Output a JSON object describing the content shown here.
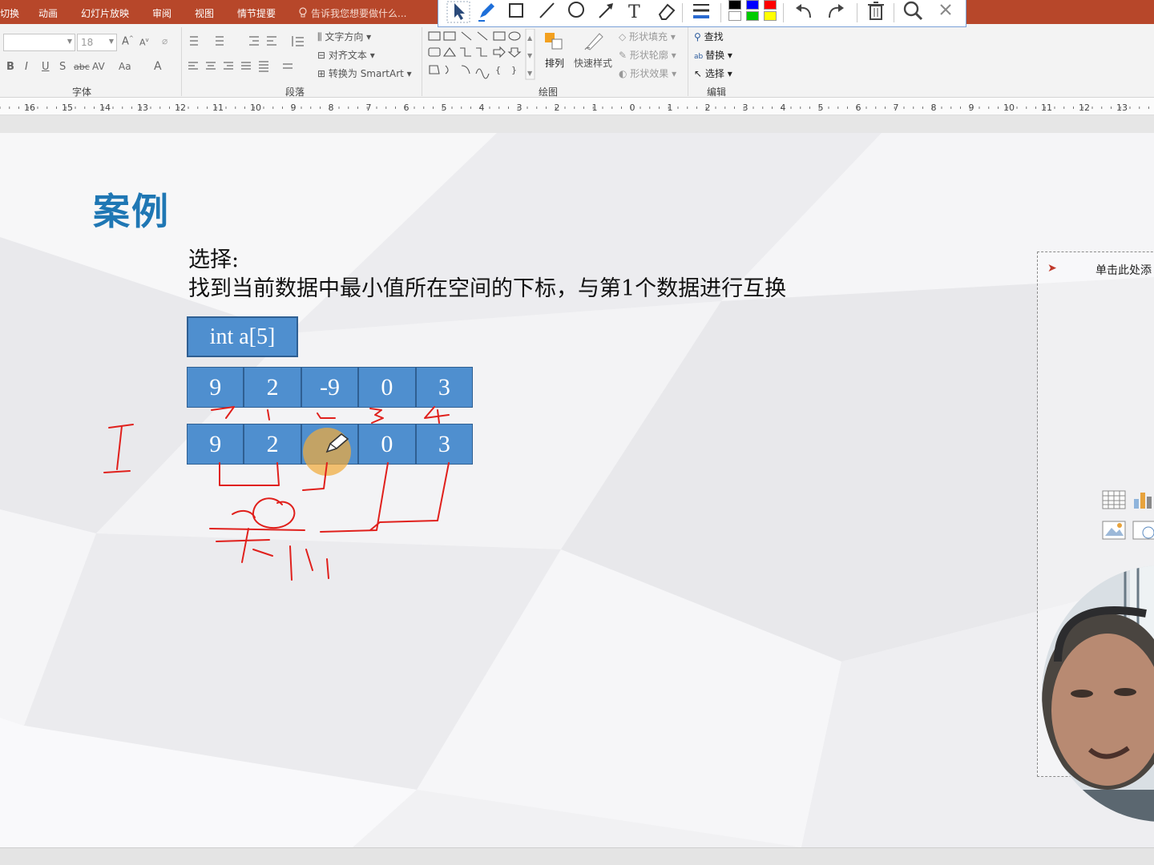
{
  "tabs": {
    "transitions": "切换",
    "animations": "动画",
    "slideshow": "幻灯片放映",
    "review": "审阅",
    "view": "视图",
    "storyboard": "情节提要",
    "tell_me": "告诉我您想要做什么..."
  },
  "ribbon": {
    "font_size": "18",
    "font_group_label": "字体",
    "paragraph_group_label": "段落",
    "drawing_group_label": "绘图",
    "editing_group_label": "编辑",
    "text_direction": "文字方向",
    "align_text": "对齐文本",
    "convert_smartart": "转换为 SmartArt",
    "arrange": "排列",
    "quick_styles": "快速样式",
    "shape_fill": "形状填充",
    "shape_outline": "形状轮廓",
    "shape_effects": "形状效果",
    "find": "查找",
    "replace": "替换",
    "select": "选择",
    "bold": "B",
    "italic": "I",
    "underline": "U",
    "shadow": "S",
    "strikethrough": "abc",
    "char_spacing": "AV",
    "change_case": "Aa",
    "font_color": "A"
  },
  "ruler": {
    "labels": [
      "16",
      "15",
      "14",
      "13",
      "12",
      "11",
      "10",
      "9",
      "8",
      "7",
      "6",
      "5",
      "4",
      "3",
      "2",
      "1",
      "0",
      "1",
      "2",
      "3",
      "4",
      "5",
      "6",
      "7",
      "8",
      "9",
      "10",
      "11",
      "12",
      "13"
    ]
  },
  "slide": {
    "title": "案例",
    "line1": "选择:",
    "line2": "找到当前数据中最小值所在空间的下标，与第1个数据进行互换",
    "var_label": "int a[5]",
    "row1": [
      "9",
      "2",
      "-9",
      "0",
      "3"
    ],
    "row2": [
      "9",
      "2",
      "",
      "0",
      "3"
    ]
  },
  "notes": {
    "text": "单击此处添",
    "arrow": "➤"
  },
  "colors": {
    "tab_bar": "#b7472a",
    "title": "#1f77b4",
    "cell_fill": "#4f8fcf",
    "cell_border": "#2f5f92",
    "ink": "#e0201c",
    "pen_highlight": "#f0aa3c"
  },
  "pen_toolbar": {
    "tools": [
      "select-arrow-icon",
      "pen-icon",
      "rectangle-icon",
      "line-icon",
      "ellipse-icon",
      "arrow-icon",
      "text-icon",
      "eraser-icon",
      "line-width-icon"
    ],
    "colors": [
      "#000000",
      "#0000ff",
      "#ff0000",
      "#ffffff",
      "#00cc00",
      "#ffff00"
    ]
  }
}
